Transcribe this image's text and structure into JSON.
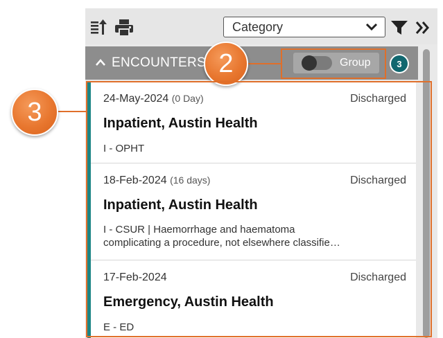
{
  "toolbar": {
    "category_value": "Category"
  },
  "encounters": {
    "title": "ENCOUNTERS",
    "group_label": "Group",
    "count": "3"
  },
  "cards": [
    {
      "date": "24-May-2024",
      "duration": "(0 Day)",
      "status": "Discharged",
      "title": "Inpatient, Austin Health",
      "detail_line1": "I - OPHT",
      "detail_line2": ""
    },
    {
      "date": "18-Feb-2024",
      "duration": "(16 days)",
      "status": "Discharged",
      "title": "Inpatient, Austin Health",
      "detail_line1": "I - CSUR | Haemorrhage and haematoma",
      "detail_line2": "complicating a procedure, not elsewhere classifie…"
    },
    {
      "date": "17-Feb-2024",
      "duration": "",
      "status": "Discharged",
      "title": "Emergency, Austin Health",
      "detail_line1": "E - ED",
      "detail_line2": ""
    }
  ],
  "callouts": {
    "two": "2",
    "three": "3"
  },
  "colors": {
    "accent_teal": "#1c8585",
    "callout_orange": "#e06f2a",
    "header_gray": "#8d8d8d"
  }
}
